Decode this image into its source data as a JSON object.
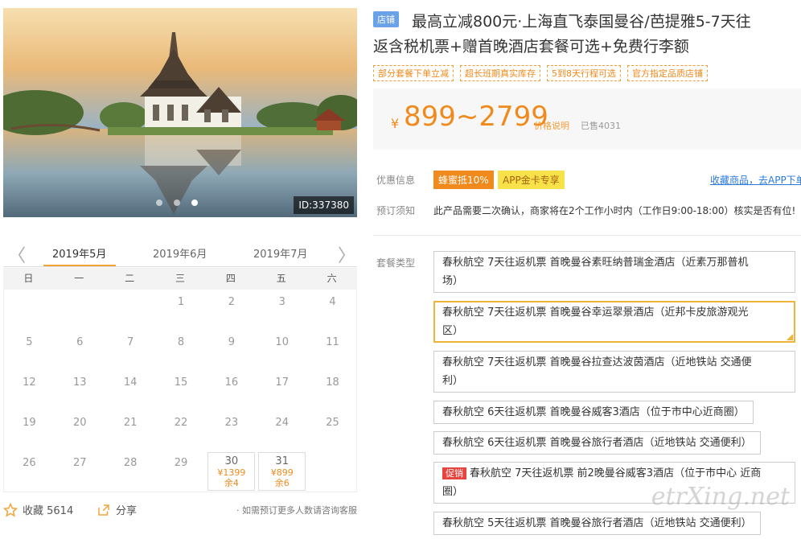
{
  "hero": {
    "image_id": "ID:337380",
    "dots": 3,
    "active_dot": 2
  },
  "product": {
    "shop_badge": "店铺",
    "title_line1": "最高立减800元·上海直飞泰国曼谷/芭提雅5-7天往",
    "title_line2": "返含税机票+赠首晚酒店套餐可选+免费行李额",
    "tags": [
      "部分套餐下单立减",
      "超长班期真实库存",
      "5到8天行程可选",
      "官方指定品质店铺"
    ],
    "currency": "¥",
    "price": "899~2799",
    "price_note": "价格说明",
    "sold": "已售4031"
  },
  "discount": {
    "label": "优惠信息",
    "promo1": "蜂蜜抵10%",
    "promo2": "APP金卡专享",
    "app_link": "收藏商品，去APP下单"
  },
  "booking": {
    "label": "预订须知",
    "text": "此产品需要二次确认，商家将在2个工作小时内（工作日9:00-18:00）核实是否有位!"
  },
  "packages": {
    "label": "套餐类型",
    "items": [
      {
        "l1": "春秋航空 7天往返机票 首晚曼谷素旺纳普瑞金酒店（近素万那普机",
        "l2": "场）",
        "selected": false,
        "sale": ""
      },
      {
        "l1": "春秋航空 7天往返机票 首晚曼谷幸运翠景酒店（近邦卡皮旅游观光",
        "l2": "区）",
        "selected": true,
        "sale": ""
      },
      {
        "l1": "春秋航空 7天往返机票 首晚曼谷拉查达波茵酒店（近地铁站 交通便",
        "l2": "利）",
        "selected": false,
        "sale": ""
      },
      {
        "l1": "春秋航空 6天往返机票 首晚曼谷威客3酒店（位于市中心近商圈）",
        "l2": "",
        "selected": false,
        "sale": ""
      },
      {
        "l1": "春秋航空 6天往返机票 首晚曼谷旅行者酒店（近地铁站 交通便利）",
        "l2": "",
        "selected": false,
        "sale": ""
      },
      {
        "l1": "春秋航空 7天往返机票 前2晚曼谷威客3酒店（位于市中心 近商",
        "l2": "圈）",
        "selected": false,
        "sale": "促销"
      },
      {
        "l1": "春秋航空 5天往返机票 首晚曼谷旅行者酒店（近地铁站 交通便利）",
        "l2": "",
        "selected": false,
        "sale": ""
      }
    ]
  },
  "calendar": {
    "prev_arrow": "〈",
    "next_arrow": "〉",
    "months": [
      "2019年5月",
      "2019年6月",
      "2019年7月"
    ],
    "active_month": 0,
    "weekdays": [
      "日",
      "一",
      "二",
      "三",
      "四",
      "五",
      "六"
    ],
    "days": [
      "1",
      "2",
      "3",
      "4",
      "5",
      "6",
      "7",
      "8",
      "9",
      "10",
      "11",
      "12",
      "13",
      "14",
      "15",
      "16",
      "17",
      "18",
      "19",
      "20",
      "21",
      "22",
      "23",
      "24",
      "25",
      "26",
      "27",
      "28",
      "29",
      "30",
      "31"
    ],
    "special": {
      "30": {
        "price": "¥1399",
        "remain": "余4"
      },
      "31": {
        "price": "¥899",
        "remain": "余6"
      }
    }
  },
  "footer": {
    "fav_label": "收藏 5614",
    "share_label": "分享",
    "tip": "· 如需预订更多人数请咨询客服"
  },
  "watermark": "etrXing.net"
}
